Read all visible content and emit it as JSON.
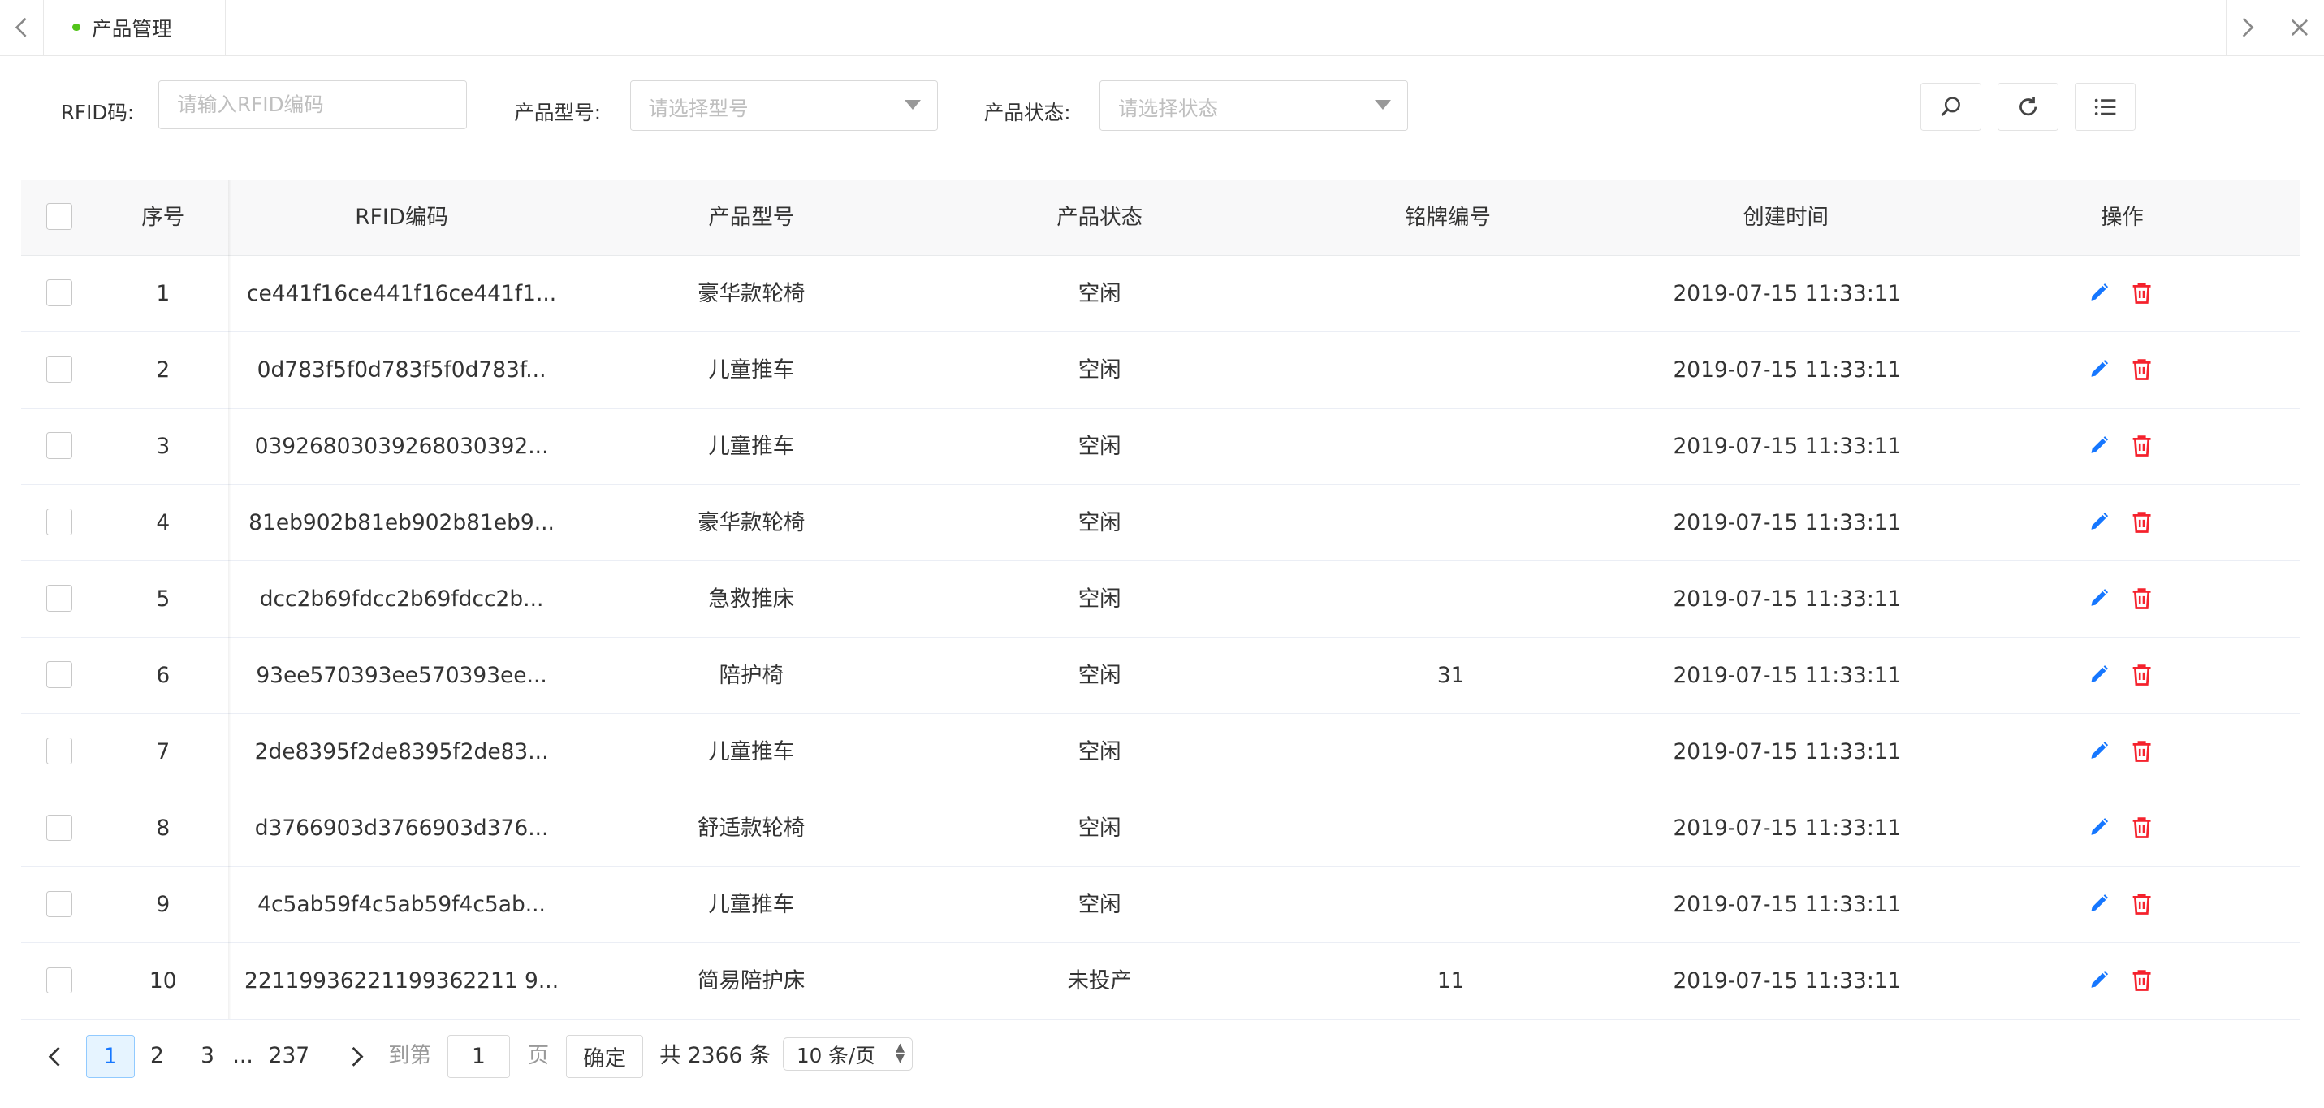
{
  "tabbar": {
    "prev_glyph": "‹",
    "next_glyph": "›",
    "close_glyph": "×",
    "active_tab": "产品管理"
  },
  "filters": {
    "rfid_label": "RFID码:",
    "rfid_placeholder": "请输入RFID编码",
    "model_label": "产品型号:",
    "model_placeholder": "请选择型号",
    "status_label": "产品状态:",
    "status_placeholder": "请选择状态"
  },
  "toolbar": {
    "icons": [
      "search-icon",
      "refresh-icon",
      "column-list-icon"
    ]
  },
  "table": {
    "columns": [
      "序号",
      "RFID编码",
      "产品型号",
      "产品状态",
      "铭牌编号",
      "创建时间",
      "操作"
    ],
    "rows": [
      {
        "index": "1",
        "rfid": "ce441f16ce441f16ce441f1...",
        "model": "豪华款轮椅",
        "status": "空闲",
        "nameplate": "",
        "created": "2019-07-15 11:33:11"
      },
      {
        "index": "2",
        "rfid": "0d783f5f0d783f5f0d783f...",
        "model": "儿童推车",
        "status": "空闲",
        "nameplate": "",
        "created": "2019-07-15 11:33:11"
      },
      {
        "index": "3",
        "rfid": "03926803039268030392...",
        "model": "儿童推车",
        "status": "空闲",
        "nameplate": "",
        "created": "2019-07-15 11:33:11"
      },
      {
        "index": "4",
        "rfid": "81eb902b81eb902b81eb9...",
        "model": "豪华款轮椅",
        "status": "空闲",
        "nameplate": "",
        "created": "2019-07-15 11:33:11"
      },
      {
        "index": "5",
        "rfid": "dcc2b69fdcc2b69fdcc2b...",
        "model": "急救推床",
        "status": "空闲",
        "nameplate": "",
        "created": "2019-07-15 11:33:11"
      },
      {
        "index": "6",
        "rfid": "93ee570393ee570393ee...",
        "model": "陪护椅",
        "status": "空闲",
        "nameplate": "31",
        "created": "2019-07-15 11:33:11"
      },
      {
        "index": "7",
        "rfid": "2de8395f2de8395f2de83...",
        "model": "儿童推车",
        "status": "空闲",
        "nameplate": "",
        "created": "2019-07-15 11:33:11"
      },
      {
        "index": "8",
        "rfid": "d3766903d3766903d376...",
        "model": "舒适款轮椅",
        "status": "空闲",
        "nameplate": "",
        "created": "2019-07-15 11:33:11"
      },
      {
        "index": "9",
        "rfid": "4c5ab59f4c5ab59f4c5ab...",
        "model": "儿童推车",
        "status": "空闲",
        "nameplate": "",
        "created": "2019-07-15 11:33:11"
      },
      {
        "index": "10",
        "rfid": "22119936221199362211 9...",
        "model": "简易陪护床",
        "status": "未投产",
        "nameplate": "11",
        "created": "2019-07-15 11:33:11"
      }
    ]
  },
  "pagination": {
    "prev_glyph": "‹",
    "next_glyph": "›",
    "pages": [
      "1",
      "2",
      "3"
    ],
    "ellipsis": "...",
    "last_page": "237",
    "current_page": "1",
    "goto_label": "到第",
    "goto_value": "1",
    "page_suffix": "页",
    "confirm_label": "确定",
    "total_text": "共 2366 条",
    "page_size": "10 条/页"
  },
  "colors": {
    "edit_icon": "#1677ff",
    "delete_icon": "#f5222d",
    "active_dot": "#52c41a"
  }
}
